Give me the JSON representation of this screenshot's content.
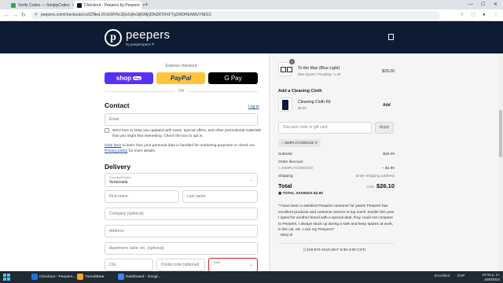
{
  "browser": {
    "tabs": [
      {
        "label": "Verify Codes — SimplyCodes",
        "active": false,
        "color": "#34a853"
      },
      {
        "label": "Checkout - Peepers by Peepers",
        "active": true,
        "color": "#0d1b33"
      }
    ],
    "new_tab": "+",
    "url": "peepers.com/checkouts/cn/Z2NwLXVzLWVhc3QxOjAxSjlGMjQ0N2RTRXFTg2WDHENMUYN01C"
  },
  "site": {
    "logo_letter": "p",
    "logo_name": "peepers",
    "logo_sub": "by peeperspecs ®"
  },
  "express": {
    "title": "Express checkout",
    "shop_pay": "shop",
    "shop_pay_badge": "Pay",
    "paypal": "PayPal",
    "gpay": "G Pay",
    "or": "OR"
  },
  "contact": {
    "heading": "Contact",
    "login": "Log in",
    "email_placeholder": "Email",
    "opt_in": "We'd love to keep you updated with news, special offers, and other promotional materials that you might find interesting. Check the box to opt in.",
    "privacy_link1": "Click here",
    "privacy_mid": " to learn how your personal data is handled for marketing purposes or check our ",
    "privacy_link2": "Privacy policy",
    "privacy_end": " for more details."
  },
  "delivery": {
    "heading": "Delivery",
    "country_label": "Country/Region",
    "country_value": "Venezuela",
    "first_name": "First name",
    "last_name": "Last name",
    "company": "Company (optional)",
    "address": "Address",
    "apartment": "Apartment, suite, etc. (optional)",
    "city": "City",
    "postal": "Postal code (optional)",
    "state": "State"
  },
  "summary": {
    "item": {
      "qty": "1",
      "name": "To the Max (Blue Light)",
      "variant": "Blue Quartz / Reading / 1.25",
      "price": "$29.00"
    },
    "upsell_heading": "Add a Cleaning Cloth",
    "upsell": {
      "name": "Cleaning Cloth Kit",
      "price": "$6.00",
      "action": "Add"
    },
    "discount_placeholder": "Discount code or gift card",
    "apply": "Apply",
    "applied_code": "SIMPLYCODES10",
    "subtotal_label": "Subtotal",
    "subtotal": "$29.00",
    "order_discount_label": "Order discount",
    "discount_code": "SIMPLYCODES10",
    "discount_value": "− $2.90",
    "shipping_label": "Shipping",
    "shipping_value": "Enter shipping address",
    "total_label": "Total",
    "currency": "USD",
    "total": "$26.10",
    "savings_label": "TOTAL SAVINGS",
    "savings_value": "$2.90",
    "quote": "\"I have been a satisfied Peepers customer for years! Peepers has excellent products and customer service is top notch. Earlier this year I opted for another brand with a special deal, they could not compare to Peepers, I always stock up during a sale and keep spares at work, in the car, etc. Love my Peepers!\"",
    "author": "- Mary B",
    "phone": "219-872-4410 (M-F 8:30-4:00 CST)"
  },
  "taskbar": {
    "items": [
      {
        "label": "Checkout - Peepers...",
        "color": "#1a73e8"
      },
      {
        "label": "TunnelBear",
        "color": "#f5a623"
      },
      {
        "label": "Dashboard - Googl...",
        "color": "#4285f4"
      }
    ],
    "lang": "ESP",
    "weather": "Excellent",
    "time": "10:15 p. m.",
    "date": "16/9/2024"
  }
}
